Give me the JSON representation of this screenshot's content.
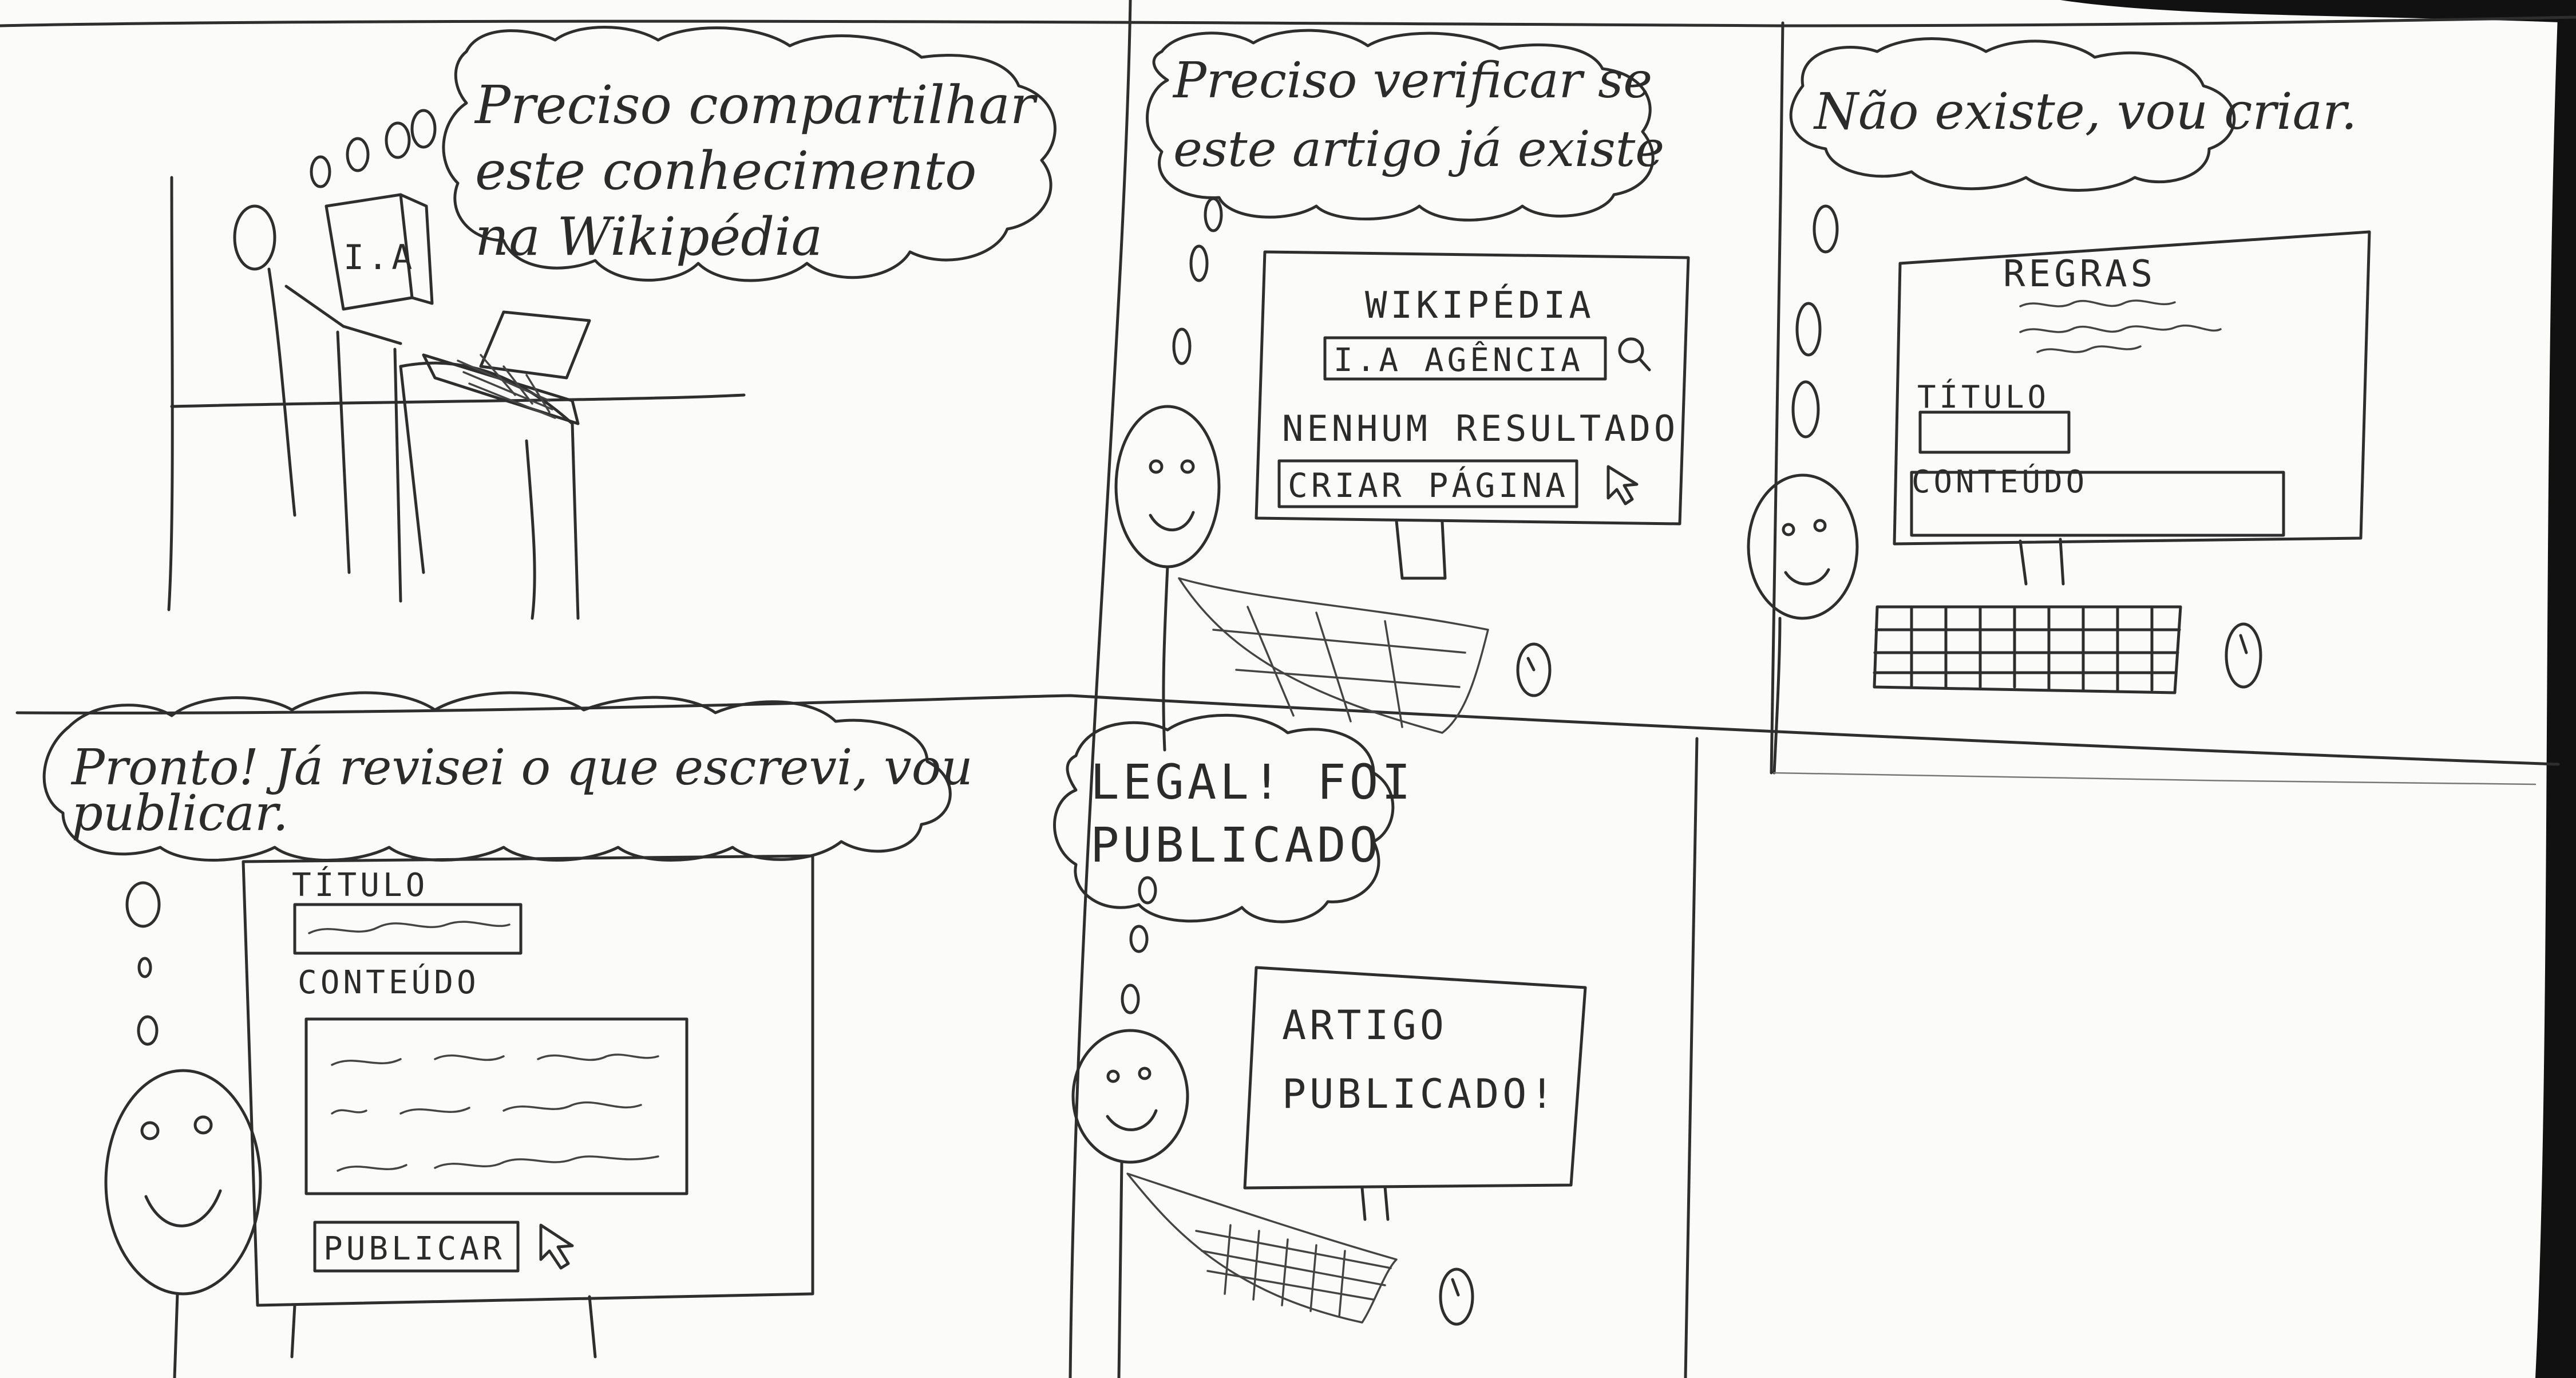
{
  "comic": {
    "panel1": {
      "speech": [
        "Preciso compartilhar",
        "este conhecimento",
        "na Wikipédia"
      ],
      "book_label": "I.A"
    },
    "panel2": {
      "speech": [
        "Preciso verificar se",
        "este artigo já existe"
      ],
      "site_title": "WIKIPÉDIA",
      "search_text": "I.A AGÊNCIA",
      "no_result": "NENHUM RESULTADO",
      "create_button": "CRIAR PÁGINA"
    },
    "panel3": {
      "speech": [
        "Não existe, vou criar."
      ],
      "rules_title": "REGRAS",
      "title_label": "TÍTULO",
      "content_label": "CONTEÚDO"
    },
    "panel4": {
      "speech": [
        "Pronto! Já revisei o que escrevi, vou",
        "publicar."
      ],
      "title_label": "TÍTULO",
      "content_label": "CONTEÚDO",
      "publish_button": "PUBLICAR"
    },
    "panel5": {
      "speech": [
        "LEGAL! FOI",
        "PUBLICADO"
      ],
      "message": [
        "ARTIGO",
        "PUBLICADO!"
      ]
    }
  },
  "colors": {
    "paper": "#fbfbfa",
    "ink": "#2e2e2e",
    "background": "#111111"
  }
}
